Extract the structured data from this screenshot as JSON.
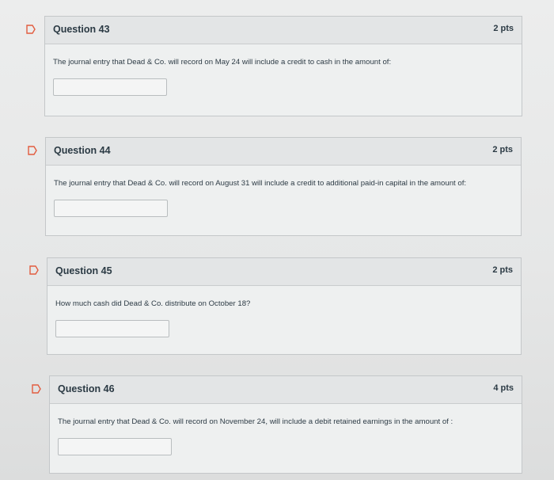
{
  "questions": [
    {
      "title": "Question 43",
      "points": "2 pts",
      "text": "The journal entry that Dead & Co. will record on May 24 will include a credit to cash in the amount of:",
      "answer": ""
    },
    {
      "title": "Question 44",
      "points": "2 pts",
      "text": "The journal entry that Dead & Co. will record on August 31 will include a credit to additional paid-in capital in the amount of:",
      "answer": ""
    },
    {
      "title": "Question 45",
      "points": "2 pts",
      "text": "How much cash did Dead & Co. distribute on October 18?",
      "answer": ""
    },
    {
      "title": "Question 46",
      "points": "4 pts",
      "text": "The journal entry that Dead & Co. will record on November 24, will include a debit retained earnings in the amount of :",
      "answer": ""
    }
  ],
  "icons": {
    "flag": "bookmark-flag-icon"
  },
  "colors": {
    "flag_outline": "#e25c3f",
    "header_bg": "#e3e5e6",
    "border": "#c4c7c9"
  }
}
